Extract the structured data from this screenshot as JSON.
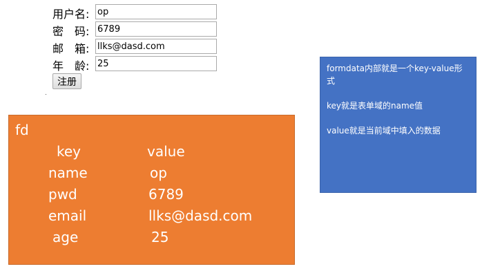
{
  "form": {
    "fields": [
      {
        "label": "用户名:",
        "value": "op"
      },
      {
        "label": "密　码:",
        "value": "6789"
      },
      {
        "label": "邮　箱:",
        "value": "llks@dasd.com"
      },
      {
        "label": "年　龄:",
        "value": "25"
      }
    ],
    "submit_label": "注册"
  },
  "fd": {
    "title": "fd",
    "header": {
      "key": "key",
      "value": "value"
    },
    "rows": [
      {
        "key": "name",
        "value": "op"
      },
      {
        "key": "pwd",
        "value": "6789"
      },
      {
        "key": "email",
        "value": "llks@dasd.com"
      },
      {
        "key": "age",
        "value": "25"
      }
    ]
  },
  "note": {
    "lines": [
      "formdata内部就是一个key-value形式",
      "key就是表单域的name值",
      "value就是当前域中填入的数据"
    ]
  },
  "colors": {
    "fd_background": "#ed7d31",
    "note_background": "#4472c4"
  }
}
